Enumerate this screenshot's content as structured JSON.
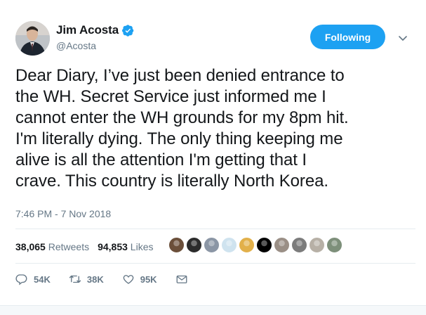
{
  "author": {
    "name": "Jim Acosta",
    "handle": "@Acosta",
    "verified": true
  },
  "follow_button": {
    "label": "Following"
  },
  "tweet": {
    "lines": [
      "Dear Diary, I’ve just been denied entrance to",
      "the WH. Secret Service just informed me I",
      "cannot enter the WH grounds for my 8pm hit.",
      "I'm literally dying. The only thing keeping me",
      "alive is all the attention I'm getting that I",
      "crave. This country is literally North Korea."
    ],
    "timestamp": "7:46 PM - 7 Nov 2018"
  },
  "stats": {
    "retweets_count": "38,065",
    "retweets_label": "Retweets",
    "likes_count": "94,853",
    "likes_label": "Likes"
  },
  "likers_colors": [
    "#6b4f3a",
    "#2b2b2b",
    "#8b96a5",
    "#cfe3ef",
    "#e2b04a",
    "#000000",
    "#9a8f86",
    "#7c7c7c",
    "#b7b0a6",
    "#7d8f7a"
  ],
  "actions": {
    "reply_count": "54K",
    "retweet_count": "38K",
    "like_count": "95K"
  },
  "colors": {
    "accent": "#1da1f2",
    "text": "#14171a",
    "muted": "#657786"
  }
}
